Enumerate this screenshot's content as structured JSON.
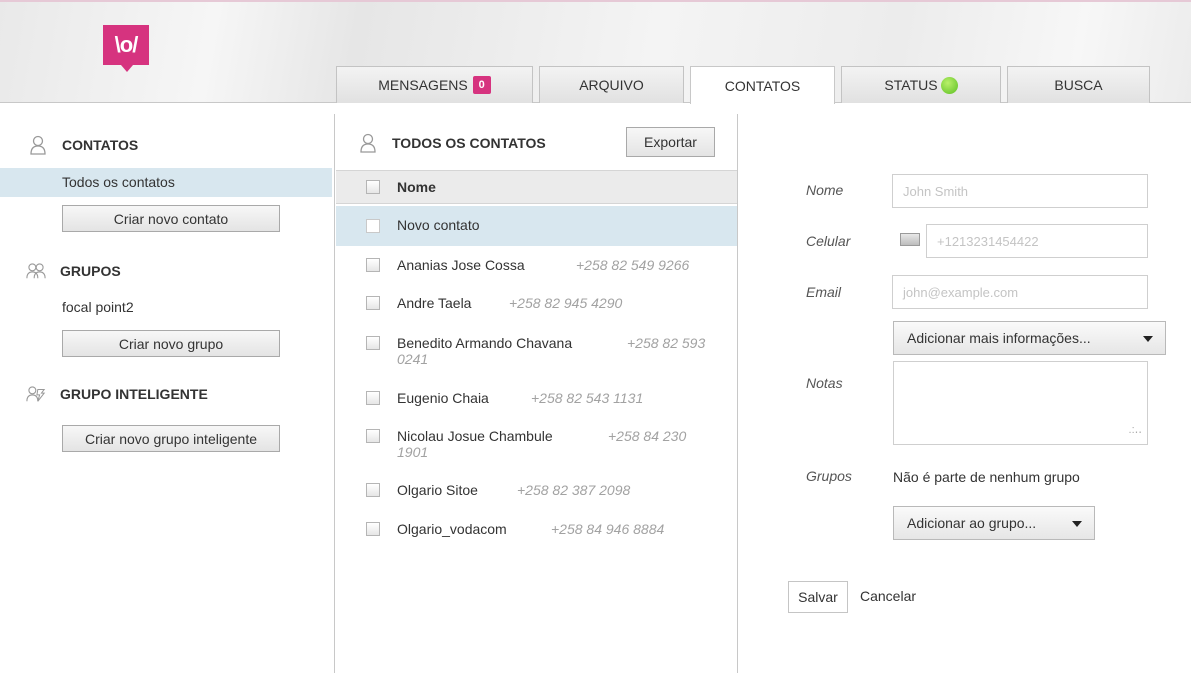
{
  "header": {
    "logo_text": "\\o/",
    "tabs": [
      {
        "label": "MENSAGENS",
        "badge": "0"
      },
      {
        "label": "ARQUIVO"
      },
      {
        "label": "CONTATOS"
      },
      {
        "label": "STATUS"
      },
      {
        "label": "BUSCA"
      }
    ],
    "active_tab": "CONTATOS",
    "status_color": "#5bbf22",
    "accent_color": "#d6337f"
  },
  "sidebar": {
    "contacts_title": "CONTATOS",
    "all_contacts": "Todos os contatos",
    "create_contact": "Criar novo contato",
    "groups_title": "GRUPOS",
    "group_items": [
      "focal point2"
    ],
    "create_group": "Criar novo grupo",
    "smart_group_title": "GRUPO INTELIGENTE",
    "create_smart_group": "Criar novo grupo inteligente"
  },
  "list": {
    "title": "TODOS OS CONTATOS",
    "export_label": "Exportar",
    "column_name": "Nome",
    "new_contact": "Novo contato",
    "contacts": [
      {
        "name": "Ananias Jose Cossa",
        "phone": "+258 82 549 9266"
      },
      {
        "name": "Andre Taela",
        "phone": "+258 82 945 4290"
      },
      {
        "name": "Benedito Armando Chavana",
        "phone": "+258 82 593",
        "phone_cont": "0241"
      },
      {
        "name": "Eugenio Chaia",
        "phone": "+258 82 543 1131"
      },
      {
        "name": "Nicolau Josue Chambule",
        "phone": "+258 84 230",
        "phone_cont": "1901"
      },
      {
        "name": "Olgario Sitoe",
        "phone": "+258 82 387 2098"
      },
      {
        "name": "Olgario_vodacom",
        "phone": "+258 84 946 8884"
      }
    ]
  },
  "form": {
    "name_label": "Nome",
    "name_placeholder": "John Smith",
    "phone_label": "Celular",
    "phone_placeholder": "+1213231454422",
    "email_label": "Email",
    "email_placeholder": "john@example.com",
    "more_info": "Adicionar mais informações...",
    "notes_label": "Notas",
    "groups_label": "Grupos",
    "groups_value": "Não é parte de nenhum grupo",
    "add_to_group": "Adicionar ao grupo...",
    "save": "Salvar",
    "cancel": "Cancelar"
  }
}
